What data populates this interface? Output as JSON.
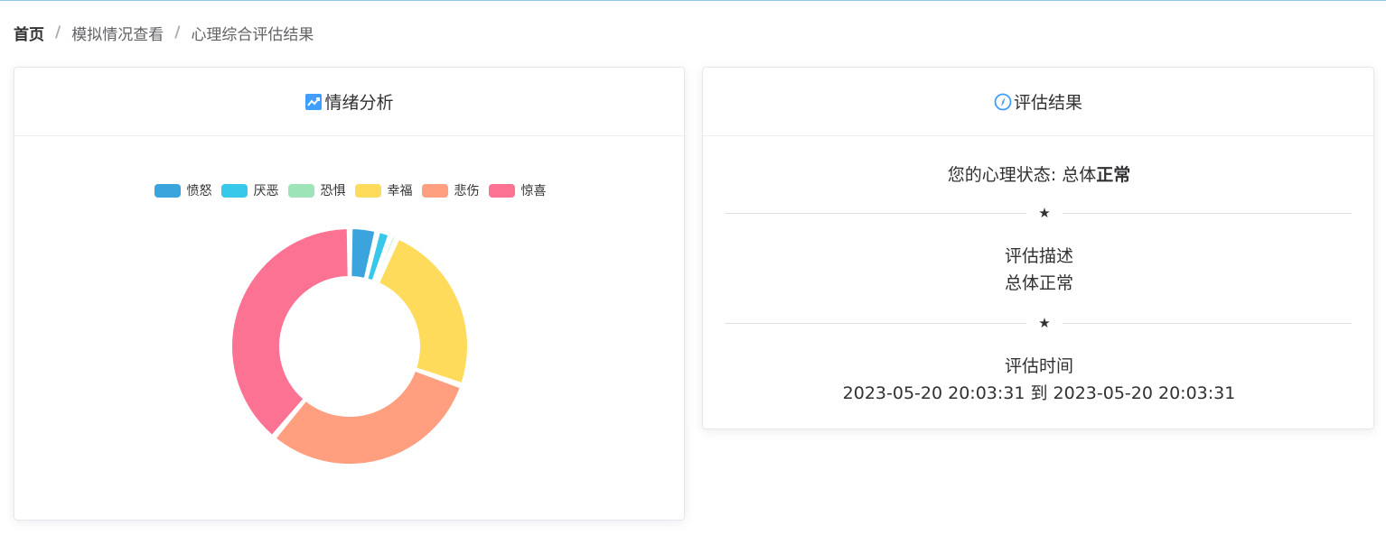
{
  "breadcrumb": {
    "home": "首页",
    "separator": "/",
    "level1": "模拟情况查看",
    "level2": "心理综合评估结果"
  },
  "emotion_card": {
    "title": "情绪分析",
    "icon": "trend-chart-icon"
  },
  "result_card": {
    "title": "评估结果",
    "icon": "compass-icon",
    "status_prefix": "您的心理状态: 总体",
    "status_value": "正常",
    "divider_symbol": "★",
    "description_label": "评估描述",
    "description_value": "总体正常",
    "time_label": "评估时间",
    "time_value": "2023-05-20 20:03:31 到 2023-05-20 20:03:31"
  },
  "colors": {
    "accent": "#409eff",
    "top_border": "#8fc5ea"
  },
  "chart_data": {
    "type": "pie",
    "variant": "donut",
    "legend_position": "top",
    "categories": [
      "愤怒",
      "厌恶",
      "恐惧",
      "幸福",
      "悲伤",
      "惊喜"
    ],
    "values": [
      3,
      1.5,
      0.7,
      19,
      24.5,
      31
    ],
    "colors": [
      "#3ba4dc",
      "#37c8ea",
      "#9de5b8",
      "#ffdb5c",
      "#ff9f7f",
      "#fb7293"
    ]
  }
}
